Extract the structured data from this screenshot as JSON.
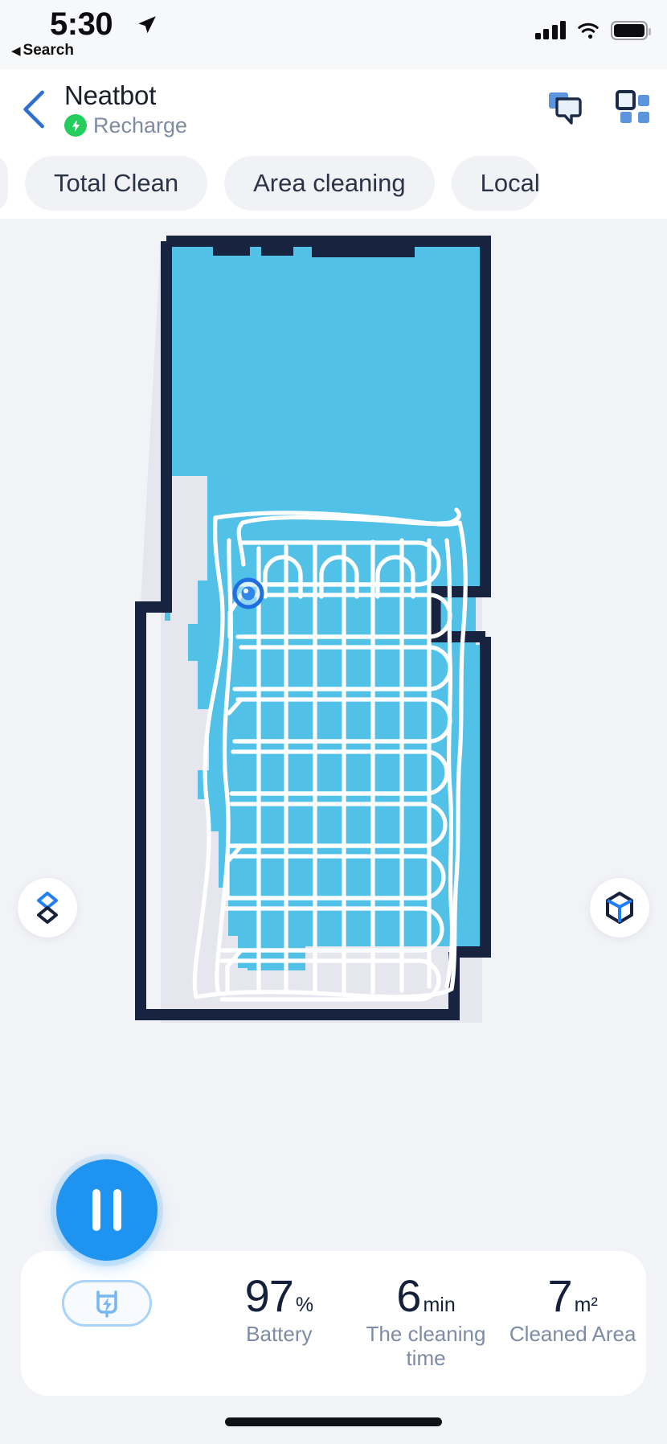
{
  "status_bar": {
    "time": "5:30",
    "back_label": "Search",
    "back_caret": "◀",
    "location_icon": "location-arrow-icon",
    "cellular_icon": "cellular-signal-icon",
    "wifi_icon": "wifi-icon",
    "battery_icon": "battery-icon"
  },
  "header": {
    "back_icon": "chevron-left-icon",
    "title": "Neatbot",
    "status_text": "Recharge",
    "status_icon": "charging-bolt-icon",
    "status_color": "#24cd5c",
    "actions": [
      {
        "name": "chat-icon"
      },
      {
        "name": "dashboard-grid-icon"
      }
    ]
  },
  "tabs": [
    {
      "label": ""
    },
    {
      "label": "Total Clean"
    },
    {
      "label": "Area cleaning"
    },
    {
      "label": "Local"
    }
  ],
  "map": {
    "robot_marker": "robot-position-marker",
    "layers_button": "map-layers-icon",
    "view3d_button": "map-3d-cube-icon",
    "colors": {
      "cleaned_fill": "#51c1e8",
      "wall": "#18233f",
      "path": "#ffffff",
      "unexplored": "#e6e7ee",
      "background": "#f2f3f7"
    }
  },
  "controls": {
    "pause_button": "pause-button",
    "dock_button": "return-to-dock-button",
    "dock_icon": "charging-dock-icon"
  },
  "stats": [
    {
      "value": "97",
      "unit": "%",
      "label": "Battery"
    },
    {
      "value": "6",
      "unit": "min",
      "label": "The cleaning time"
    },
    {
      "value": "7",
      "unit": "m²",
      "label": "Cleaned Area"
    }
  ]
}
